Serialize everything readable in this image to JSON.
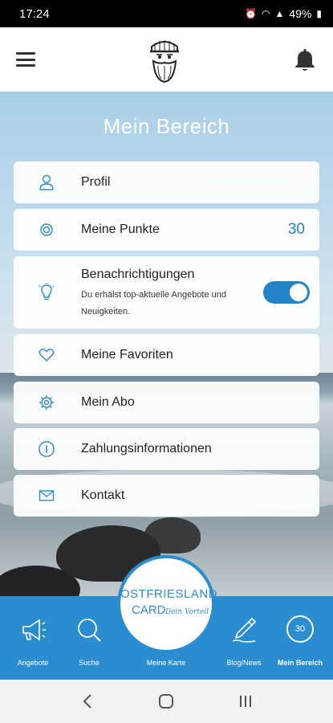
{
  "status_bar": {
    "time": "17:24",
    "battery": "49%"
  },
  "page": {
    "title": "Mein Bereich"
  },
  "menu": {
    "profile": "Profil",
    "points": "Meine Punkte",
    "points_value": "30",
    "notifications": "Benachrichtigungen",
    "notifications_sub": "Du erhälst top-aktuelle Angebote und Neuigkeiten.",
    "notifications_enabled": true,
    "favorites": "Meine Favoriten",
    "subscription": "Mein Abo",
    "payment": "Zahlungsinformationen",
    "contact": "Kontakt"
  },
  "card": {
    "line1": "OSTFRIESLAND",
    "line2": "CARD",
    "tagline": "Dein Vorteil"
  },
  "bottom_nav": {
    "offers": "Angebote",
    "search": "Suche",
    "my_card": "Meine Karte",
    "blog": "Blog/News",
    "my_area": "Mein Bereich",
    "my_area_points": "30"
  },
  "colors": {
    "accent": "#2a8dcf",
    "value_blue": "#2283c6"
  }
}
